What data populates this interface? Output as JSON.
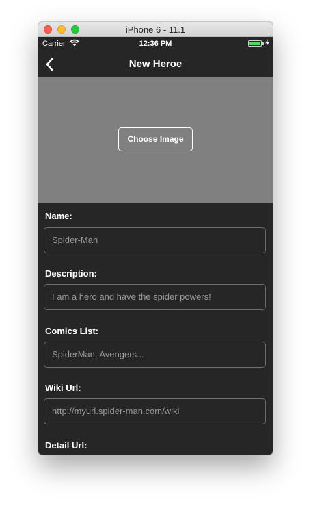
{
  "window": {
    "title": "iPhone 6 - 11.1"
  },
  "status_bar": {
    "carrier": "Carrier",
    "time": "12:36 PM",
    "battery_color": "#4cd964"
  },
  "nav": {
    "back_icon": "chevron-left-icon",
    "title": "New Heroe"
  },
  "image_picker": {
    "button_label": "Choose Image",
    "background": "#808080"
  },
  "form": {
    "fields": [
      {
        "label": "Name:",
        "placeholder": "Spider-Man"
      },
      {
        "label": "Description:",
        "placeholder": "I am a hero and have the spider powers!"
      },
      {
        "label": "Comics List:",
        "placeholder": "SpiderMan, Avengers..."
      },
      {
        "label": "Wiki Url:",
        "placeholder": "http://myurl.spider-man.com/wiki"
      },
      {
        "label": "Detail Url:",
        "placeholder": ""
      }
    ]
  }
}
